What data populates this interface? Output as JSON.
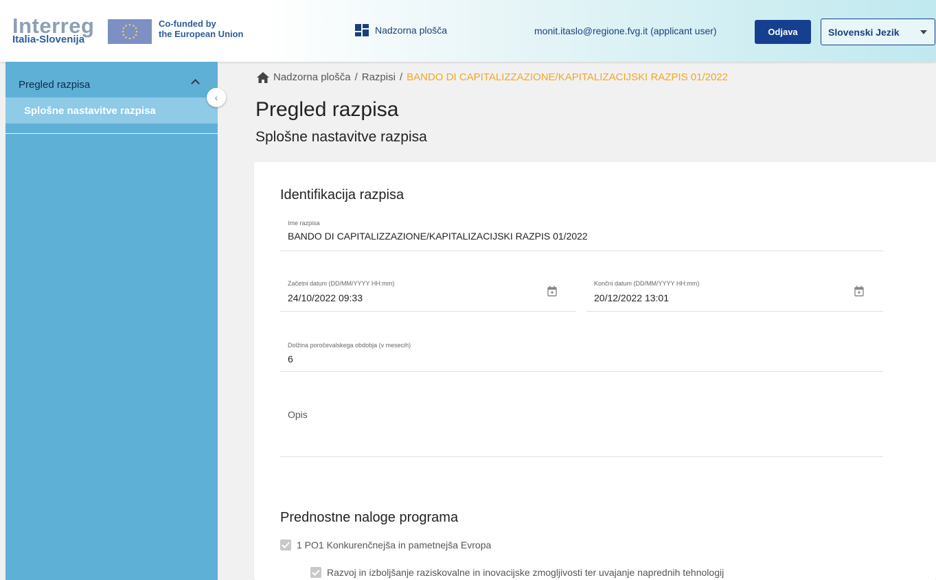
{
  "header": {
    "logo_title": "Interreg",
    "logo_subtitle": "Italia-Slovenija",
    "cofunded_line1": "Co-funded by",
    "cofunded_line2": "the European Union",
    "dashboard_label": "Nadzorna plošča",
    "user_email": "monit.itaslo@regione.fvg.it (applicant user)",
    "logout_label": "Odjava",
    "language_selected": "Slovenski Jezik"
  },
  "sidebar": {
    "group_label": "Pregled razpisa",
    "items": [
      {
        "label": "Splošne nastavitve razpisa"
      }
    ]
  },
  "breadcrumb": {
    "items": [
      "Nadzorna plošča",
      "Razpisi",
      "BANDO DI CAPITALIZZAZIONE/KAPITALIZACIJSKI RAZPIS 01/2022"
    ],
    "separator": "/"
  },
  "page": {
    "title": "Pregled razpisa",
    "subtitle": "Splošne nastavitve razpisa"
  },
  "identification": {
    "title": "Identifikacija razpisa",
    "name_label": "Ime razpisa",
    "name_value": "BANDO DI CAPITALIZZAZIONE/KAPITALIZACIJSKI RAZPIS 01/2022",
    "start_label": "Začetni datum (DD/MM/YYYY HH:mm)",
    "start_value": "24/10/2022 09:33",
    "end_label": "Končni datum (DD/MM/YYYY HH:mm)",
    "end_value": "20/12/2022 13:01",
    "period_label": "Dolžina poročevalskega obdobja (v mesecih)",
    "period_value": "6",
    "description_label": "Opis"
  },
  "priorities": {
    "title": "Prednostne naloge programa",
    "items": [
      {
        "label": "1 PO1 Konkurenčnejša in pametnejša Evropa",
        "checked": true
      },
      {
        "label": "Razvoj in izboljšanje raziskovalne in inovacijske zmogljivosti ter uvajanje naprednih tehnologij",
        "checked": true
      }
    ]
  },
  "colors": {
    "sidebar_bg": "#5fb0d7",
    "sidebar_active": "#8fcae6",
    "logout_bg": "#163f8f",
    "breadcrumb_current": "#f5a623"
  }
}
